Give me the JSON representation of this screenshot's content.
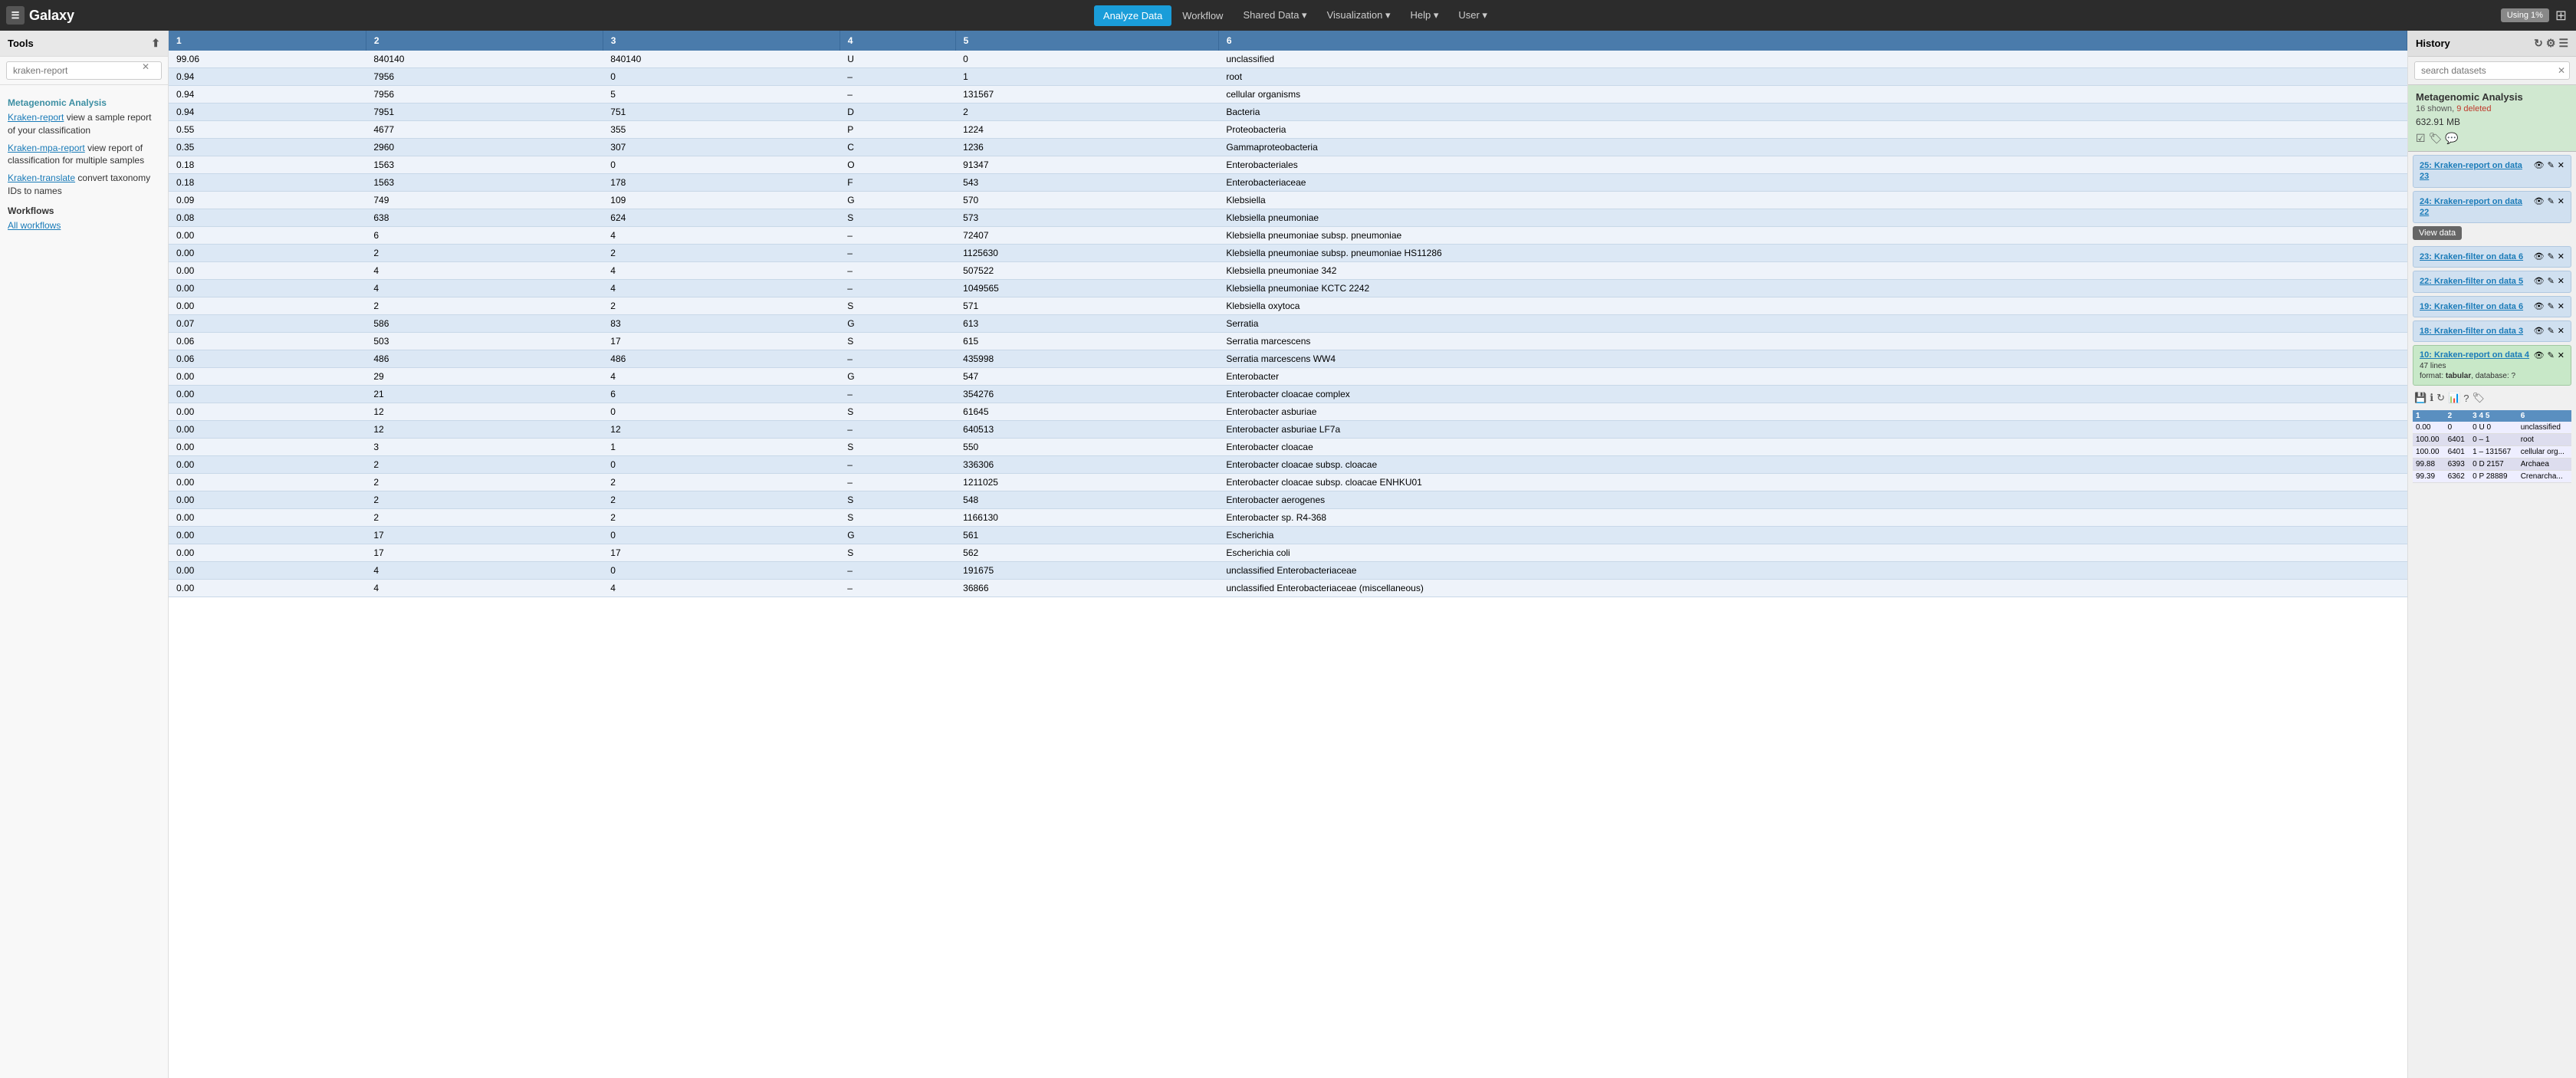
{
  "navbar": {
    "brand": "Galaxy",
    "nav_items": [
      {
        "label": "Analyze Data",
        "active": true,
        "id": "analyze-data"
      },
      {
        "label": "Workflow",
        "id": "workflow"
      },
      {
        "label": "Shared Data",
        "id": "shared-data",
        "dropdown": true
      },
      {
        "label": "Visualization",
        "id": "visualization",
        "dropdown": true
      },
      {
        "label": "Help",
        "id": "help",
        "dropdown": true
      },
      {
        "label": "User",
        "id": "user",
        "dropdown": true
      }
    ],
    "usage": "Using 1%"
  },
  "tools_panel": {
    "title": "Tools",
    "search_placeholder": "kraken-report",
    "section_title": "Metagenomic Analysis",
    "tools": [
      {
        "link": "Kraken-report",
        "text": " view a sample report of your classification"
      },
      {
        "link": "Kraken-mpa-report",
        "text": " view report of classification for multiple samples"
      },
      {
        "link": "Kraken-translate",
        "text": " convert taxonomy IDs to names"
      }
    ],
    "workflows_title": "Workflows",
    "workflows_link": "All workflows"
  },
  "table": {
    "headers": [
      "1",
      "2",
      "3",
      "4",
      "5",
      "6"
    ],
    "rows": [
      [
        "99.06",
        "840140",
        "840140",
        "U",
        "0",
        "unclassified"
      ],
      [
        "0.94",
        "7956",
        "0",
        "–",
        "1",
        "root"
      ],
      [
        "0.94",
        "7956",
        "5",
        "–",
        "131567",
        "cellular organisms"
      ],
      [
        "0.94",
        "7951",
        "751",
        "D",
        "2",
        "Bacteria"
      ],
      [
        "0.55",
        "4677",
        "355",
        "P",
        "1224",
        "Proteobacteria"
      ],
      [
        "0.35",
        "2960",
        "307",
        "C",
        "1236",
        "Gammaproteobacteria"
      ],
      [
        "0.18",
        "1563",
        "0",
        "O",
        "91347",
        "Enterobacteriales"
      ],
      [
        "0.18",
        "1563",
        "178",
        "F",
        "543",
        "Enterobacteriaceae"
      ],
      [
        "0.09",
        "749",
        "109",
        "G",
        "570",
        "Klebsiella"
      ],
      [
        "0.08",
        "638",
        "624",
        "S",
        "573",
        "Klebsiella pneumoniae"
      ],
      [
        "0.00",
        "6",
        "4",
        "–",
        "72407",
        "Klebsiella pneumoniae subsp. pneumoniae"
      ],
      [
        "0.00",
        "2",
        "2",
        "–",
        "1125630",
        "Klebsiella pneumoniae subsp. pneumoniae HS11286"
      ],
      [
        "0.00",
        "4",
        "4",
        "–",
        "507522",
        "Klebsiella pneumoniae 342"
      ],
      [
        "0.00",
        "4",
        "4",
        "–",
        "1049565",
        "Klebsiella pneumoniae KCTC 2242"
      ],
      [
        "0.00",
        "2",
        "2",
        "S",
        "571",
        "Klebsiella oxytoca"
      ],
      [
        "0.07",
        "586",
        "83",
        "G",
        "613",
        "Serratia"
      ],
      [
        "0.06",
        "503",
        "17",
        "S",
        "615",
        "Serratia marcescens"
      ],
      [
        "0.06",
        "486",
        "486",
        "–",
        "435998",
        "Serratia marcescens WW4"
      ],
      [
        "0.00",
        "29",
        "4",
        "G",
        "547",
        "Enterobacter"
      ],
      [
        "0.00",
        "21",
        "6",
        "–",
        "354276",
        "Enterobacter cloacae complex"
      ],
      [
        "0.00",
        "12",
        "0",
        "S",
        "61645",
        "Enterobacter asburiae"
      ],
      [
        "0.00",
        "12",
        "12",
        "–",
        "640513",
        "Enterobacter asburiae LF7a"
      ],
      [
        "0.00",
        "3",
        "1",
        "S",
        "550",
        "Enterobacter cloacae"
      ],
      [
        "0.00",
        "2",
        "0",
        "–",
        "336306",
        "Enterobacter cloacae subsp. cloacae"
      ],
      [
        "0.00",
        "2",
        "2",
        "–",
        "1211025",
        "Enterobacter cloacae subsp. cloacae ENHKU01"
      ],
      [
        "0.00",
        "2",
        "2",
        "S",
        "548",
        "Enterobacter aerogenes"
      ],
      [
        "0.00",
        "2",
        "2",
        "S",
        "1166130",
        "Enterobacter sp. R4-368"
      ],
      [
        "0.00",
        "17",
        "0",
        "G",
        "561",
        "Escherichia"
      ],
      [
        "0.00",
        "17",
        "17",
        "S",
        "562",
        "Escherichia coli"
      ],
      [
        "0.00",
        "4",
        "0",
        "–",
        "191675",
        "unclassified Enterobacteriaceae"
      ],
      [
        "0.00",
        "4",
        "4",
        "–",
        "36866",
        "unclassified Enterobacteriaceae (miscellaneous)"
      ]
    ]
  },
  "history_panel": {
    "title": "History",
    "search_placeholder": "search datasets",
    "history_name": "Metagenomic Analysis",
    "shown": "16 shown,",
    "deleted": "9 deleted",
    "size": "632.91 MB",
    "items": [
      {
        "id": "25",
        "title": "25: Kraken-report on data 23",
        "actions": [
          "eye",
          "pencil",
          "times"
        ],
        "active": false
      },
      {
        "id": "24",
        "title": "24: Kraken-report on data 22",
        "actions": [
          "eye",
          "pencil",
          "times"
        ],
        "active": false,
        "tooltip": "View data"
      },
      {
        "id": "23",
        "title": "23: Kraken-filter on data 6",
        "actions": [
          "eye",
          "pencil",
          "times"
        ],
        "active": false
      },
      {
        "id": "22",
        "title": "22: Kraken-filter on data 5",
        "actions": [
          "eye",
          "pencil",
          "times"
        ],
        "active": false
      },
      {
        "id": "19",
        "title": "19: Kraken-filter on data 6",
        "actions": [
          "eye",
          "pencil",
          "times"
        ],
        "active": false
      },
      {
        "id": "18",
        "title": "18: Kraken-filter on data 3",
        "actions": [
          "eye",
          "pencil",
          "times"
        ],
        "active": false
      },
      {
        "id": "10",
        "title": "10: Kraken-report on data 4",
        "actions": [
          "eye",
          "pencil",
          "times"
        ],
        "active": true,
        "lines": "47 lines",
        "format": "tabular",
        "database": "?",
        "mini_table": {
          "headers": [
            "1",
            "2",
            "3 4 5",
            "6"
          ],
          "rows": [
            [
              "0.00",
              "0",
              "0 U 0",
              "unclassified"
            ],
            [
              "100.00",
              "6401",
              "0 – 1",
              "root"
            ],
            [
              "100.00",
              "6401",
              "1 – 131567",
              "cellular org..."
            ],
            [
              "99.88",
              "6393",
              "0 D 2157",
              "Archaea"
            ],
            [
              "99.39",
              "6362",
              "0 P 28889",
              "Crenarcha..."
            ]
          ]
        }
      }
    ]
  }
}
